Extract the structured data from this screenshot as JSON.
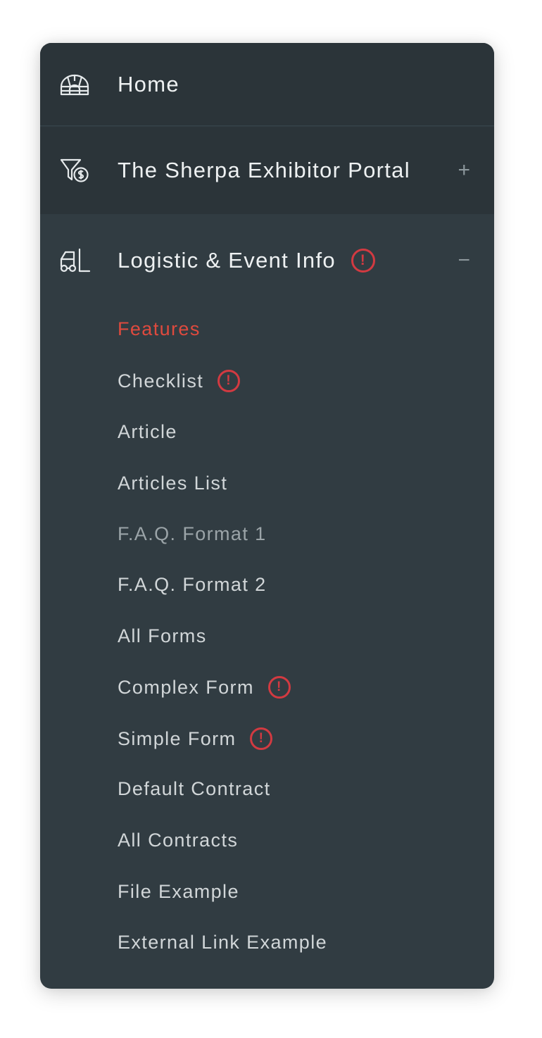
{
  "nav": {
    "home": {
      "label": "Home",
      "icon": "igloo-icon"
    },
    "portal": {
      "label": "The Sherpa Exhibitor Portal",
      "icon": "funnel-dollar-icon",
      "toggle": "+"
    },
    "logistic": {
      "label": "Logistic & Event Info",
      "icon": "forklift-icon",
      "toggle": "−",
      "alert": "!"
    },
    "subitems": [
      {
        "label": "Features",
        "state": "active"
      },
      {
        "label": "Checklist",
        "alert": "!"
      },
      {
        "label": "Article"
      },
      {
        "label": "Articles List"
      },
      {
        "label": "F.A.Q. Format 1",
        "state": "dim"
      },
      {
        "label": "F.A.Q. Format 2"
      },
      {
        "label": "All Forms"
      },
      {
        "label": "Complex Form",
        "alert": "!"
      },
      {
        "label": "Simple Form",
        "alert": "!"
      },
      {
        "label": "Default Contract"
      },
      {
        "label": "All Contracts"
      },
      {
        "label": "File Example"
      },
      {
        "label": "External Link Example"
      }
    ]
  },
  "colors": {
    "panel": "#313c42",
    "header_dark": "#2b3439",
    "active": "#df4a3e",
    "alert": "#d23a41",
    "text": "#eef1f2"
  }
}
